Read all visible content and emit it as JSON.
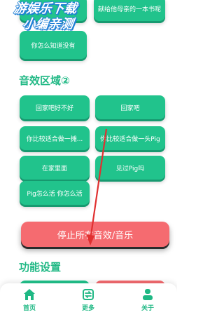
{
  "watermark": {
    "line1": "游娱乐下载",
    "line2": "小编亲测"
  },
  "top_tiles": {
    "left_label": "",
    "right_label": "献给他母亲的一本书呢",
    "left2_label": "你怎么知道没有"
  },
  "sound_section": {
    "title": "音效区域②",
    "buttons": [
      "回家吧好不好",
      "回家吧",
      "你比较适合做一摊...",
      "你比较适合做一头Pig",
      "在家里面",
      "见过Pig吗",
      "Pig怎么活 你怎么活"
    ]
  },
  "stop_button": {
    "label": "停止所有音效/音乐"
  },
  "settings_section": {
    "title": "功能设置"
  },
  "tabbar": {
    "home_label": "首页",
    "more_label": "更多",
    "about_label": "关于"
  },
  "colors": {
    "primary": "#21c38c",
    "title": "#1fb884",
    "stop": "#f56b70",
    "annotation_arrow": "#e03030"
  }
}
